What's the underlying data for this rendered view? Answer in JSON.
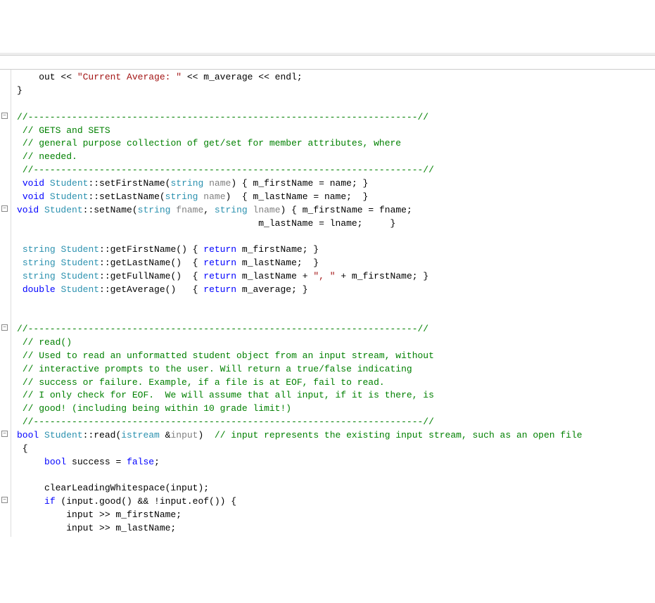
{
  "lines": [
    {
      "indent": "    ",
      "segments": [
        {
          "t": "out << ",
          "c": ""
        },
        {
          "t": "\"Current Average: \"",
          "c": "str"
        },
        {
          "t": " << m_average << endl;",
          "c": ""
        }
      ]
    },
    {
      "indent": "",
      "segments": [
        {
          "t": "}",
          "c": ""
        }
      ]
    },
    {
      "indent": "",
      "segments": []
    },
    {
      "fold": "-",
      "indent": "",
      "segments": [
        {
          "t": "//-----------------------------------------------------------------------//",
          "c": "cmt"
        }
      ]
    },
    {
      "indent": " ",
      "segments": [
        {
          "t": "// GETS and SETS",
          "c": "cmt"
        }
      ]
    },
    {
      "indent": " ",
      "segments": [
        {
          "t": "// general purpose collection of get/set for member attributes, where",
          "c": "cmt"
        }
      ]
    },
    {
      "indent": " ",
      "segments": [
        {
          "t": "// needed.",
          "c": "cmt"
        }
      ]
    },
    {
      "indent": " ",
      "segments": [
        {
          "t": "//-----------------------------------------------------------------------//",
          "c": "cmt"
        }
      ]
    },
    {
      "indent": " ",
      "segments": [
        {
          "t": "void",
          "c": "kw"
        },
        {
          "t": " ",
          "c": ""
        },
        {
          "t": "Student",
          "c": "cls"
        },
        {
          "t": "::setFirstName(",
          "c": ""
        },
        {
          "t": "string",
          "c": "cls"
        },
        {
          "t": " ",
          "c": ""
        },
        {
          "t": "name",
          "c": "param"
        },
        {
          "t": ") { m_firstName = name; }",
          "c": ""
        }
      ]
    },
    {
      "indent": " ",
      "segments": [
        {
          "t": "void",
          "c": "kw"
        },
        {
          "t": " ",
          "c": ""
        },
        {
          "t": "Student",
          "c": "cls"
        },
        {
          "t": "::setLastName(",
          "c": ""
        },
        {
          "t": "string",
          "c": "cls"
        },
        {
          "t": " ",
          "c": ""
        },
        {
          "t": "name",
          "c": "param"
        },
        {
          "t": ")  { m_lastName = name;  }",
          "c": ""
        }
      ]
    },
    {
      "fold": "-",
      "indent": "",
      "segments": [
        {
          "t": "void",
          "c": "kw"
        },
        {
          "t": " ",
          "c": ""
        },
        {
          "t": "Student",
          "c": "cls"
        },
        {
          "t": "::setName(",
          "c": ""
        },
        {
          "t": "string",
          "c": "cls"
        },
        {
          "t": " ",
          "c": ""
        },
        {
          "t": "fname",
          "c": "param"
        },
        {
          "t": ", ",
          "c": ""
        },
        {
          "t": "string",
          "c": "cls"
        },
        {
          "t": " ",
          "c": ""
        },
        {
          "t": "lname",
          "c": "param"
        },
        {
          "t": ") { m_firstName = fname;",
          "c": ""
        }
      ]
    },
    {
      "indent": "                                            ",
      "segments": [
        {
          "t": "m_lastName = lname;     }",
          "c": ""
        }
      ]
    },
    {
      "indent": "",
      "segments": []
    },
    {
      "indent": " ",
      "segments": [
        {
          "t": "string",
          "c": "cls"
        },
        {
          "t": " ",
          "c": ""
        },
        {
          "t": "Student",
          "c": "cls"
        },
        {
          "t": "::getFirstName() { ",
          "c": ""
        },
        {
          "t": "return",
          "c": "kw"
        },
        {
          "t": " m_firstName; }",
          "c": ""
        }
      ]
    },
    {
      "indent": " ",
      "segments": [
        {
          "t": "string",
          "c": "cls"
        },
        {
          "t": " ",
          "c": ""
        },
        {
          "t": "Student",
          "c": "cls"
        },
        {
          "t": "::getLastName()  { ",
          "c": ""
        },
        {
          "t": "return",
          "c": "kw"
        },
        {
          "t": " m_lastName;  }",
          "c": ""
        }
      ]
    },
    {
      "indent": " ",
      "segments": [
        {
          "t": "string",
          "c": "cls"
        },
        {
          "t": " ",
          "c": ""
        },
        {
          "t": "Student",
          "c": "cls"
        },
        {
          "t": "::getFullName()  { ",
          "c": ""
        },
        {
          "t": "return",
          "c": "kw"
        },
        {
          "t": " m_lastName + ",
          "c": ""
        },
        {
          "t": "\", \"",
          "c": "str"
        },
        {
          "t": " + m_firstName; }",
          "c": ""
        }
      ]
    },
    {
      "indent": " ",
      "segments": [
        {
          "t": "double",
          "c": "kw"
        },
        {
          "t": " ",
          "c": ""
        },
        {
          "t": "Student",
          "c": "cls"
        },
        {
          "t": "::getAverage()   { ",
          "c": ""
        },
        {
          "t": "return",
          "c": "kw"
        },
        {
          "t": " m_average; }",
          "c": ""
        }
      ]
    },
    {
      "indent": "",
      "segments": []
    },
    {
      "indent": "",
      "segments": []
    },
    {
      "fold": "-",
      "indent": "",
      "segments": [
        {
          "t": "//-----------------------------------------------------------------------//",
          "c": "cmt"
        }
      ]
    },
    {
      "indent": " ",
      "segments": [
        {
          "t": "// read()",
          "c": "cmt"
        }
      ]
    },
    {
      "indent": " ",
      "segments": [
        {
          "t": "// Used to read an unformatted student object from an input stream, without",
          "c": "cmt"
        }
      ]
    },
    {
      "indent": " ",
      "segments": [
        {
          "t": "// interactive prompts to the user. Will return a true/false indicating",
          "c": "cmt"
        }
      ]
    },
    {
      "indent": " ",
      "segments": [
        {
          "t": "// success or failure. Example, if a file is at EOF, fail to read.",
          "c": "cmt"
        }
      ]
    },
    {
      "indent": " ",
      "segments": [
        {
          "t": "// I only check for EOF.  We will assume that all input, if it is there, is",
          "c": "cmt"
        }
      ]
    },
    {
      "indent": " ",
      "segments": [
        {
          "t": "// good! (including being within 10 grade limit!)",
          "c": "cmt"
        }
      ]
    },
    {
      "indent": " ",
      "segments": [
        {
          "t": "//-----------------------------------------------------------------------//",
          "c": "cmt"
        }
      ]
    },
    {
      "fold": "-",
      "indent": "",
      "segments": [
        {
          "t": "bool",
          "c": "kw"
        },
        {
          "t": " ",
          "c": ""
        },
        {
          "t": "Student",
          "c": "cls"
        },
        {
          "t": "::read(",
          "c": ""
        },
        {
          "t": "istream",
          "c": "cls"
        },
        {
          "t": " &",
          "c": ""
        },
        {
          "t": "input",
          "c": "param"
        },
        {
          "t": ")  ",
          "c": ""
        },
        {
          "t": "// input represents the existing input stream, such as an open file",
          "c": "cmt"
        }
      ]
    },
    {
      "indent": " ",
      "segments": [
        {
          "t": "{",
          "c": ""
        }
      ]
    },
    {
      "indent": "     ",
      "segments": [
        {
          "t": "bool",
          "c": "kw"
        },
        {
          "t": " success = ",
          "c": ""
        },
        {
          "t": "false",
          "c": "kw"
        },
        {
          "t": ";",
          "c": ""
        }
      ]
    },
    {
      "indent": "",
      "segments": []
    },
    {
      "indent": "     ",
      "segments": [
        {
          "t": "clearLeadingWhitespace(input);",
          "c": ""
        }
      ]
    },
    {
      "fold": "-",
      "indent": "     ",
      "segments": [
        {
          "t": "if",
          "c": "kw"
        },
        {
          "t": " (input.good() && !input.eof()) {",
          "c": ""
        }
      ]
    },
    {
      "indent": "         ",
      "segments": [
        {
          "t": "input >> m_firstName;",
          "c": ""
        }
      ]
    },
    {
      "indent": "         ",
      "segments": [
        {
          "t": "input >> m_lastName;",
          "c": ""
        }
      ]
    }
  ]
}
